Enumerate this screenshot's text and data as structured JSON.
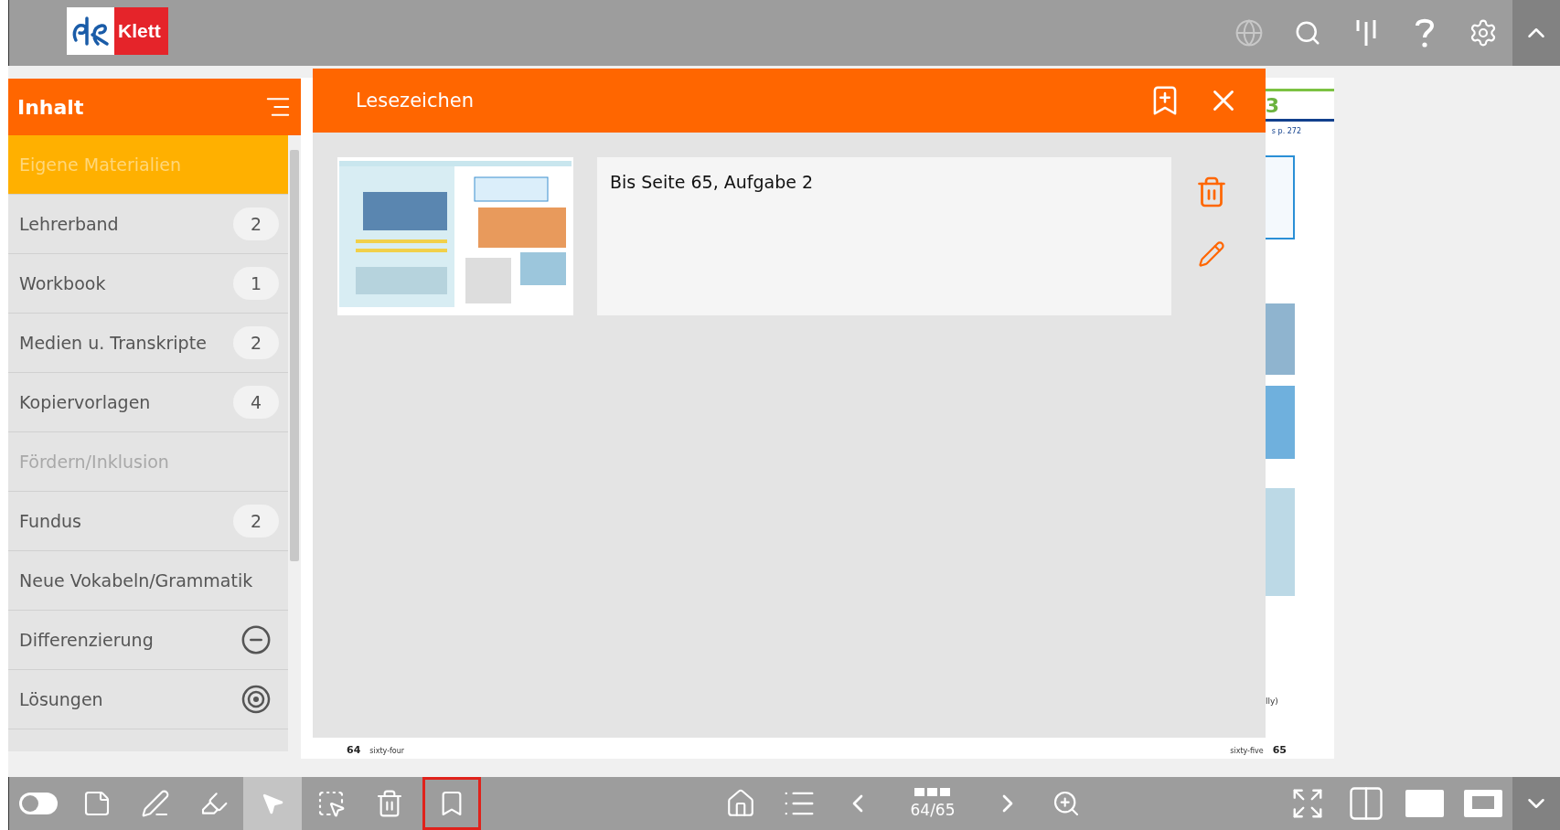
{
  "top_bar": {
    "logo_text": "Klett"
  },
  "sidebar": {
    "title": "Inhalt",
    "items": [
      {
        "label": "Eigene Materialien",
        "kind": "plain",
        "selected": true,
        "disabled": false
      },
      {
        "label": "Lehrerband",
        "kind": "count",
        "count": "2",
        "selected": false,
        "disabled": false
      },
      {
        "label": "Workbook",
        "kind": "count",
        "count": "1",
        "selected": false,
        "disabled": false
      },
      {
        "label": "Medien u. Transkripte",
        "kind": "count",
        "count": "2",
        "selected": false,
        "disabled": false
      },
      {
        "label": "Kopiervorlagen",
        "kind": "count",
        "count": "4",
        "selected": false,
        "disabled": false
      },
      {
        "label": "Fördern/Inklusion",
        "kind": "plain",
        "selected": false,
        "disabled": true
      },
      {
        "label": "Fundus",
        "kind": "count",
        "count": "2",
        "selected": false,
        "disabled": false
      },
      {
        "label": "Neue Vokabeln/Grammatik",
        "kind": "plain",
        "selected": false,
        "disabled": false
      },
      {
        "label": "Differenzierung",
        "kind": "minus",
        "selected": false,
        "disabled": false
      },
      {
        "label": "Lösungen",
        "kind": "target",
        "selected": false,
        "disabled": false
      }
    ]
  },
  "book": {
    "left_page": {
      "number": "64",
      "footer": "sixty-four"
    },
    "right_page": {
      "chapter": "3",
      "reference": "s p. 272",
      "cut_text": "lly)",
      "footer": "sixty-five",
      "number": "65"
    }
  },
  "bookmarks_dialog": {
    "title": "Lesezeichen",
    "bookmarks": [
      {
        "note": "Bis Seite 65, Aufgabe 2"
      }
    ]
  },
  "bottom_toolbar": {
    "tools": [
      {
        "kind": "switch",
        "selected": false
      },
      {
        "kind": "note",
        "selected": false
      },
      {
        "kind": "pen",
        "selected": false
      },
      {
        "kind": "marker",
        "selected": false
      },
      {
        "kind": "pointer",
        "selected": true
      },
      {
        "kind": "select",
        "selected": false
      },
      {
        "kind": "trash",
        "selected": false
      }
    ],
    "bookmarks_button": {
      "open": true
    },
    "page_indicator": "64/65"
  }
}
